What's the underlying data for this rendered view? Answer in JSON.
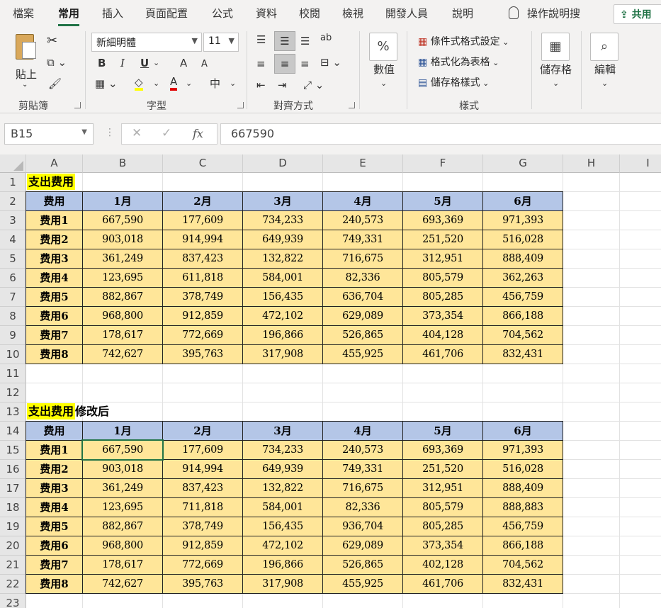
{
  "tabs": [
    "檔案",
    "常用",
    "插入",
    "頁面配置",
    "公式",
    "資料",
    "校閱",
    "檢視",
    "開發人員",
    "說明"
  ],
  "tell_me": "操作說明搜",
  "share": "共用",
  "ribbon": {
    "clipboard": {
      "paste": "貼上",
      "label": "剪貼簿"
    },
    "font": {
      "name": "新細明體",
      "size": "11",
      "label": "字型",
      "bold": "B",
      "italic": "I",
      "underline": "U",
      "grow": "A",
      "shrink": "A",
      "color": "A",
      "phonetic": "中"
    },
    "align": {
      "label": "對齊方式",
      "wrap": "ab"
    },
    "number": {
      "btn": "數值",
      "percent": "%"
    },
    "styles": {
      "cond": "條件式格式設定",
      "table": "格式化為表格",
      "cell": "儲存格樣式",
      "label": "樣式"
    },
    "cells": {
      "btn": "儲存格"
    },
    "editing": {
      "btn": "編輯"
    }
  },
  "formula_bar": {
    "name_box": "B15",
    "value": "667590",
    "fx": "fx"
  },
  "columns": [
    "A",
    "B",
    "C",
    "D",
    "E",
    "F",
    "G",
    "H",
    "I"
  ],
  "rows": [
    "1",
    "2",
    "3",
    "4",
    "5",
    "6",
    "7",
    "8",
    "9",
    "10",
    "11",
    "12",
    "13",
    "14",
    "15",
    "16",
    "17",
    "18",
    "19",
    "20",
    "21",
    "22",
    "23"
  ],
  "table1": {
    "title": "支出费用",
    "headers": [
      "费用",
      "1月",
      "2月",
      "3月",
      "4月",
      "5月",
      "6月"
    ],
    "rows": [
      [
        "费用1",
        "667,590",
        "177,609",
        "734,233",
        "240,573",
        "693,369",
        "971,393"
      ],
      [
        "费用2",
        "903,018",
        "914,994",
        "649,939",
        "749,331",
        "251,520",
        "516,028"
      ],
      [
        "费用3",
        "361,249",
        "837,423",
        "132,822",
        "716,675",
        "312,951",
        "888,409"
      ],
      [
        "费用4",
        "123,695",
        "611,818",
        "584,001",
        "82,336",
        "805,579",
        "362,263"
      ],
      [
        "费用5",
        "882,867",
        "378,749",
        "156,435",
        "636,704",
        "805,285",
        "456,759"
      ],
      [
        "费用6",
        "968,800",
        "912,859",
        "472,102",
        "629,089",
        "373,354",
        "866,188"
      ],
      [
        "费用7",
        "178,617",
        "772,669",
        "196,866",
        "526,865",
        "404,128",
        "704,562"
      ],
      [
        "费用8",
        "742,627",
        "395,763",
        "317,908",
        "455,925",
        "461,706",
        "832,431"
      ]
    ]
  },
  "table2": {
    "title_hl": "支出费用",
    "title_rest": "修改后",
    "headers": [
      "费用",
      "1月",
      "2月",
      "3月",
      "4月",
      "5月",
      "6月"
    ],
    "rows": [
      [
        "费用1",
        "667,590",
        "177,609",
        "734,233",
        "240,573",
        "693,369",
        "971,393"
      ],
      [
        "费用2",
        "903,018",
        "914,994",
        "649,939",
        "749,331",
        "251,520",
        "516,028"
      ],
      [
        "费用3",
        "361,249",
        "837,423",
        "132,822",
        "716,675",
        "312,951",
        "888,409"
      ],
      [
        "费用4",
        "123,695",
        "711,818",
        "584,001",
        "82,336",
        "805,579",
        "888,883"
      ],
      [
        "费用5",
        "882,867",
        "378,749",
        "156,435",
        "936,704",
        "805,285",
        "456,759"
      ],
      [
        "费用6",
        "968,800",
        "912,859",
        "472,102",
        "629,089",
        "373,354",
        "866,188"
      ],
      [
        "费用7",
        "178,617",
        "772,669",
        "196,866",
        "526,865",
        "402,128",
        "704,562"
      ],
      [
        "费用8",
        "742,627",
        "395,763",
        "317,908",
        "455,925",
        "461,706",
        "832,431"
      ]
    ]
  }
}
